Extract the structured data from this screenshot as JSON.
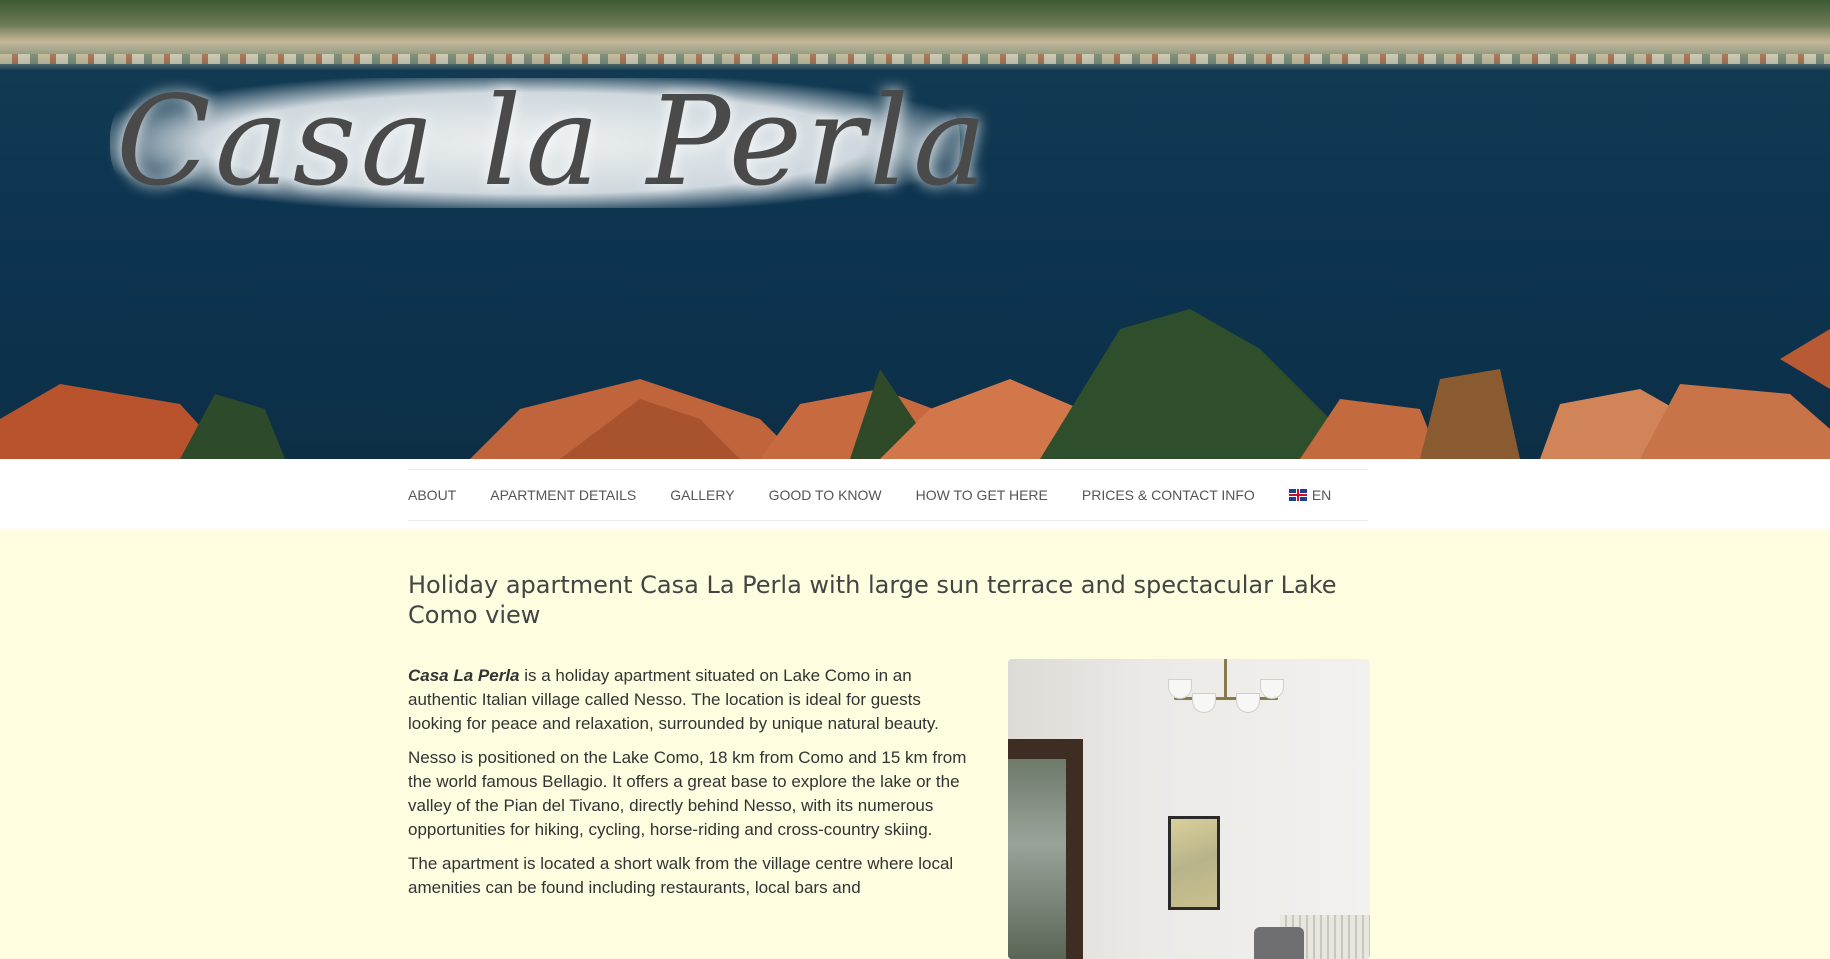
{
  "site": {
    "logo_text": "Casa la Perla"
  },
  "nav": {
    "items": [
      {
        "label": "ABOUT"
      },
      {
        "label": "APARTMENT DETAILS"
      },
      {
        "label": "GALLERY"
      },
      {
        "label": "GOOD TO KNOW"
      },
      {
        "label": "HOW TO GET HERE"
      },
      {
        "label": "PRICES & CONTACT INFO"
      }
    ],
    "language": {
      "label": "EN",
      "flag_icon": "uk-flag-icon"
    }
  },
  "main": {
    "title": "Holiday apartment Casa La Perla with large sun terrace and spectacular Lake Como view",
    "paragraph1_emphasis": "Casa La Perla",
    "paragraph1_rest": " is a holiday apartment situated on Lake Como in an authentic Italian village called Nesso. The location is ideal for guests looking for peace and relaxation, surrounded by unique natural beauty.",
    "paragraph2": "Nesso is positioned on the Lake Como, 18 km from Como and 15 km from the world famous Bellagio. It offers a great base to explore the lake or the valley of the Pian del Tivano, directly behind Nesso, with its numerous opportunities for hiking, cycling, horse-riding and cross-country skiing.",
    "paragraph3": "The apartment is located a short walk from the village centre where local amenities can be found including restaurants, local bars and"
  },
  "colors": {
    "page_background": "#fffde0",
    "nav_background": "#ffffff",
    "text": "#333333"
  }
}
